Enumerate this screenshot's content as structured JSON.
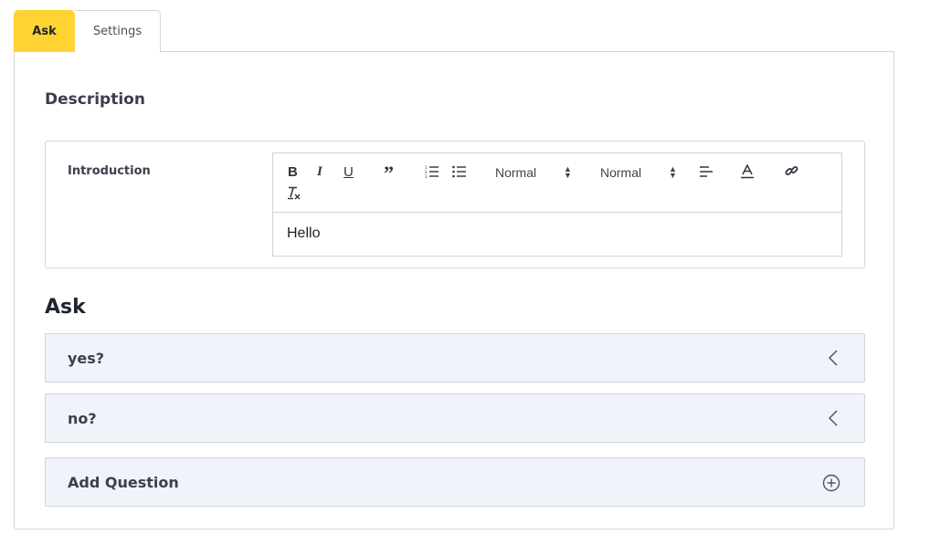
{
  "tabs": [
    {
      "label": "Ask",
      "active": true
    },
    {
      "label": "Settings",
      "active": false
    }
  ],
  "description": {
    "title": "Description",
    "field_label": "Introduction",
    "toolbar": {
      "header_select": "Normal",
      "size_select": "Normal"
    },
    "content": "Hello"
  },
  "ask": {
    "title": "Ask",
    "questions": [
      {
        "label": "yes?",
        "icon": "chevron-left-icon"
      },
      {
        "label": "no?",
        "icon": "chevron-left-icon"
      }
    ],
    "add_label": "Add Question",
    "add_icon": "plus-circle-icon"
  },
  "colors": {
    "accent": "#ffd332",
    "row_bg": "#f0f3f9",
    "border": "#d6d6d6"
  }
}
